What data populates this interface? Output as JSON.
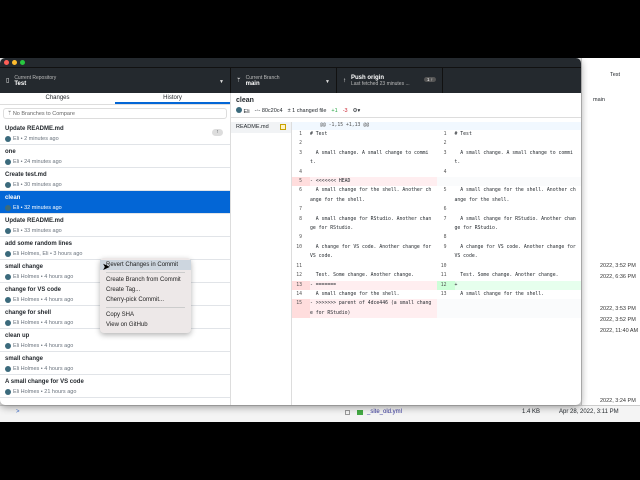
{
  "window": {
    "repo_label": "Current Repository",
    "repo": "Test",
    "branch_label": "Current Branch",
    "branch": "main",
    "push_title": "Push origin",
    "push_sub": "Last fetched 23 minutes ...",
    "push_badge": "1 ↑"
  },
  "tabs": [
    "Changes",
    "History"
  ],
  "compare_placeholder": "No Branches to Compare",
  "commits": [
    {
      "title": "Update README.md",
      "meta": "Eli • 2 minutes ago"
    },
    {
      "title": "one",
      "meta": "Eli • 24 minutes ago"
    },
    {
      "title": "Create test.md",
      "meta": "Eli • 30 minutes ago"
    },
    {
      "title": "clean",
      "meta": "Eli • 32 minutes ago"
    },
    {
      "title": "Update README.md",
      "meta": "Eli • 33 minutes ago"
    },
    {
      "title": "add some random lines",
      "meta": "Eli Holmes, Eli • 3 hours ago"
    },
    {
      "title": "small change",
      "meta": "Eli Holmes • 4 hours ago"
    },
    {
      "title": "change for VS code",
      "meta": "Eli Holmes • 4 hours ago"
    },
    {
      "title": "change for shell",
      "meta": "Eli Holmes • 4 hours ago"
    },
    {
      "title": "clean up",
      "meta": "Eli Holmes • 4 hours ago"
    },
    {
      "title": "small change",
      "meta": "Eli Holmes • 4 hours ago"
    },
    {
      "title": "A small change for VS code",
      "meta": "Eli Holmes • 21 hours ago"
    }
  ],
  "push_indicator": "↑",
  "context_menu": [
    "Revert Changes in Commit",
    "Create Branch from Commit",
    "Create Tag...",
    "Cherry-pick Commit...",
    "Copy SHA",
    "View on GitHub"
  ],
  "detail": {
    "title": "clean",
    "author": "Eli",
    "sha": "80c20c4",
    "changed": "1 changed file",
    "added": "+1",
    "removed": "-3",
    "file": "README.md",
    "hunk": "@@ -1,15 +1,13 @@"
  },
  "diff": [
    {
      "l": [
        "1",
        "# Test",
        ""
      ],
      "r": [
        "1",
        "# Test",
        ""
      ]
    },
    {
      "l": [
        "2",
        "",
        ""
      ],
      "r": [
        "2",
        "",
        ""
      ]
    },
    {
      "l": [
        "3",
        "  A small change. A small change to commit.",
        ""
      ],
      "r": [
        "3",
        "  A small change. A small change to commit.",
        ""
      ]
    },
    {
      "l": [
        "4",
        "",
        ""
      ],
      "r": [
        "4",
        "",
        ""
      ]
    },
    {
      "l": [
        "5",
        "- <<<<<<< HEAD",
        "del"
      ],
      "r": [
        "",
        "",
        "emp"
      ]
    },
    {
      "l": [
        "6",
        "  A small change for the shell. Another change for the shell.",
        ""
      ],
      "r": [
        "5",
        "  A small change for the shell. Another change for the shell.",
        ""
      ]
    },
    {
      "l": [
        "7",
        "",
        ""
      ],
      "r": [
        "6",
        "",
        ""
      ]
    },
    {
      "l": [
        "8",
        "  A small change for RStudio. Another change for RStudio.",
        ""
      ],
      "r": [
        "7",
        "  A small change for RStudio. Another change for RStudio.",
        ""
      ]
    },
    {
      "l": [
        "9",
        "",
        ""
      ],
      "r": [
        "8",
        "",
        ""
      ]
    },
    {
      "l": [
        "10",
        "  A change for VS code. Another change for VS code.",
        ""
      ],
      "r": [
        "9",
        "  A change for VS code. Another change for VS code.",
        ""
      ]
    },
    {
      "l": [
        "11",
        "",
        ""
      ],
      "r": [
        "10",
        "",
        ""
      ]
    },
    {
      "l": [
        "12",
        "  Test. Some change. Another change.",
        ""
      ],
      "r": [
        "11",
        "  Test. Some change. Another change.",
        ""
      ]
    },
    {
      "l": [
        "13",
        "- =======",
        "del"
      ],
      "r": [
        "12",
        "+",
        "add"
      ]
    },
    {
      "l": [
        "14",
        "  A small change for the shell.",
        ""
      ],
      "r": [
        "13",
        "  A small change for the shell.",
        ""
      ]
    },
    {
      "l": [
        "15",
        "- >>>>>>> parent of 4dce446 (a small change for RStudio)",
        "del"
      ],
      "r": [
        "",
        "",
        "emp"
      ]
    }
  ],
  "background": {
    "project": "Test",
    "branch": "main",
    "dates": [
      "2022, 3:52 PM",
      "2022, 6:36 PM",
      "2022, 3:53 PM",
      "2022, 3:52 PM",
      "2022, 11:40 AM",
      "2022, 3:24 PM"
    ],
    "file_name": "_site_old.yml",
    "file_size": "1.4 KB",
    "file_date": "Apr 28, 2022, 3:11 PM",
    "console_prompt": ">"
  },
  "colors": {
    "accent": "#0366d6",
    "toolbar": "#24292e"
  }
}
